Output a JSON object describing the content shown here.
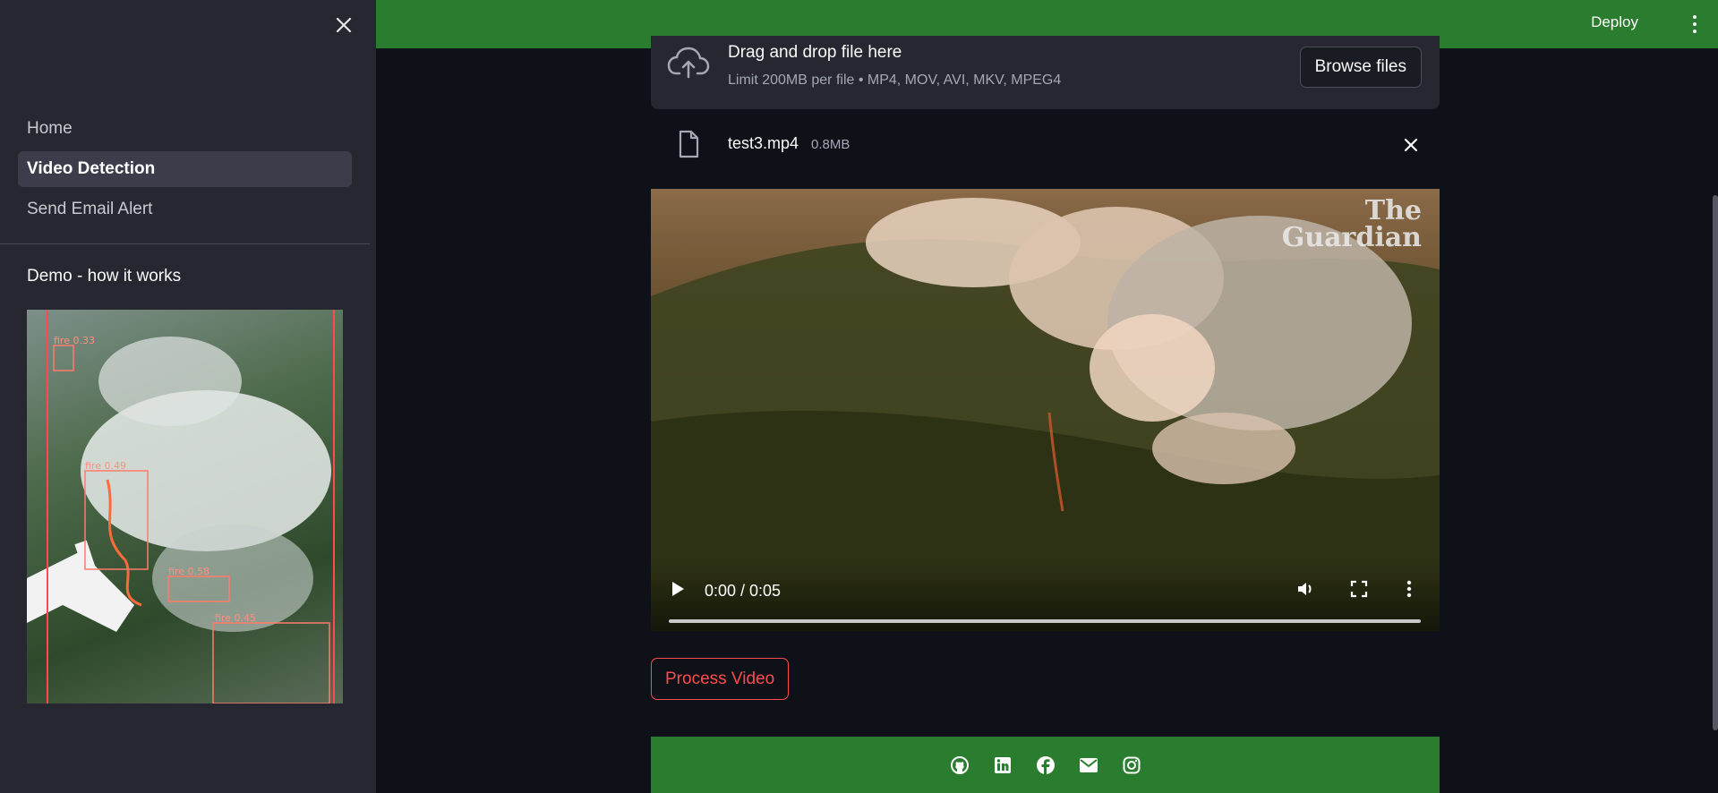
{
  "sidebar": {
    "nav": [
      {
        "label": "Home",
        "active": false
      },
      {
        "label": "Video Detection",
        "active": true
      },
      {
        "label": "Send Email Alert",
        "active": false
      }
    ],
    "demo_title": "Demo - how it works",
    "demo_labels": [
      "fire 0.33",
      "fire 0.49",
      "fire 0.58",
      "fire 0.45"
    ]
  },
  "header": {
    "deploy_label": "Deploy"
  },
  "uploader": {
    "title": "Drag and drop file here",
    "limit": "Limit 200MB per file • MP4, MOV, AVI, MKV, MPEG4",
    "browse_label": "Browse files"
  },
  "file": {
    "name": "test3.mp4",
    "size": "0.8MB"
  },
  "video": {
    "watermark_line1": "The",
    "watermark_line2": "Guardian",
    "time": "0:00 / 0:05"
  },
  "process_label": "Process Video",
  "footer_icons": [
    "github-icon",
    "linkedin-icon",
    "facebook-icon",
    "email-icon",
    "instagram-icon"
  ],
  "colors": {
    "accent_green": "#2a7d2e",
    "danger_red": "#ff4b4b",
    "sidebar_bg": "#262730",
    "app_bg": "#0e1117"
  }
}
